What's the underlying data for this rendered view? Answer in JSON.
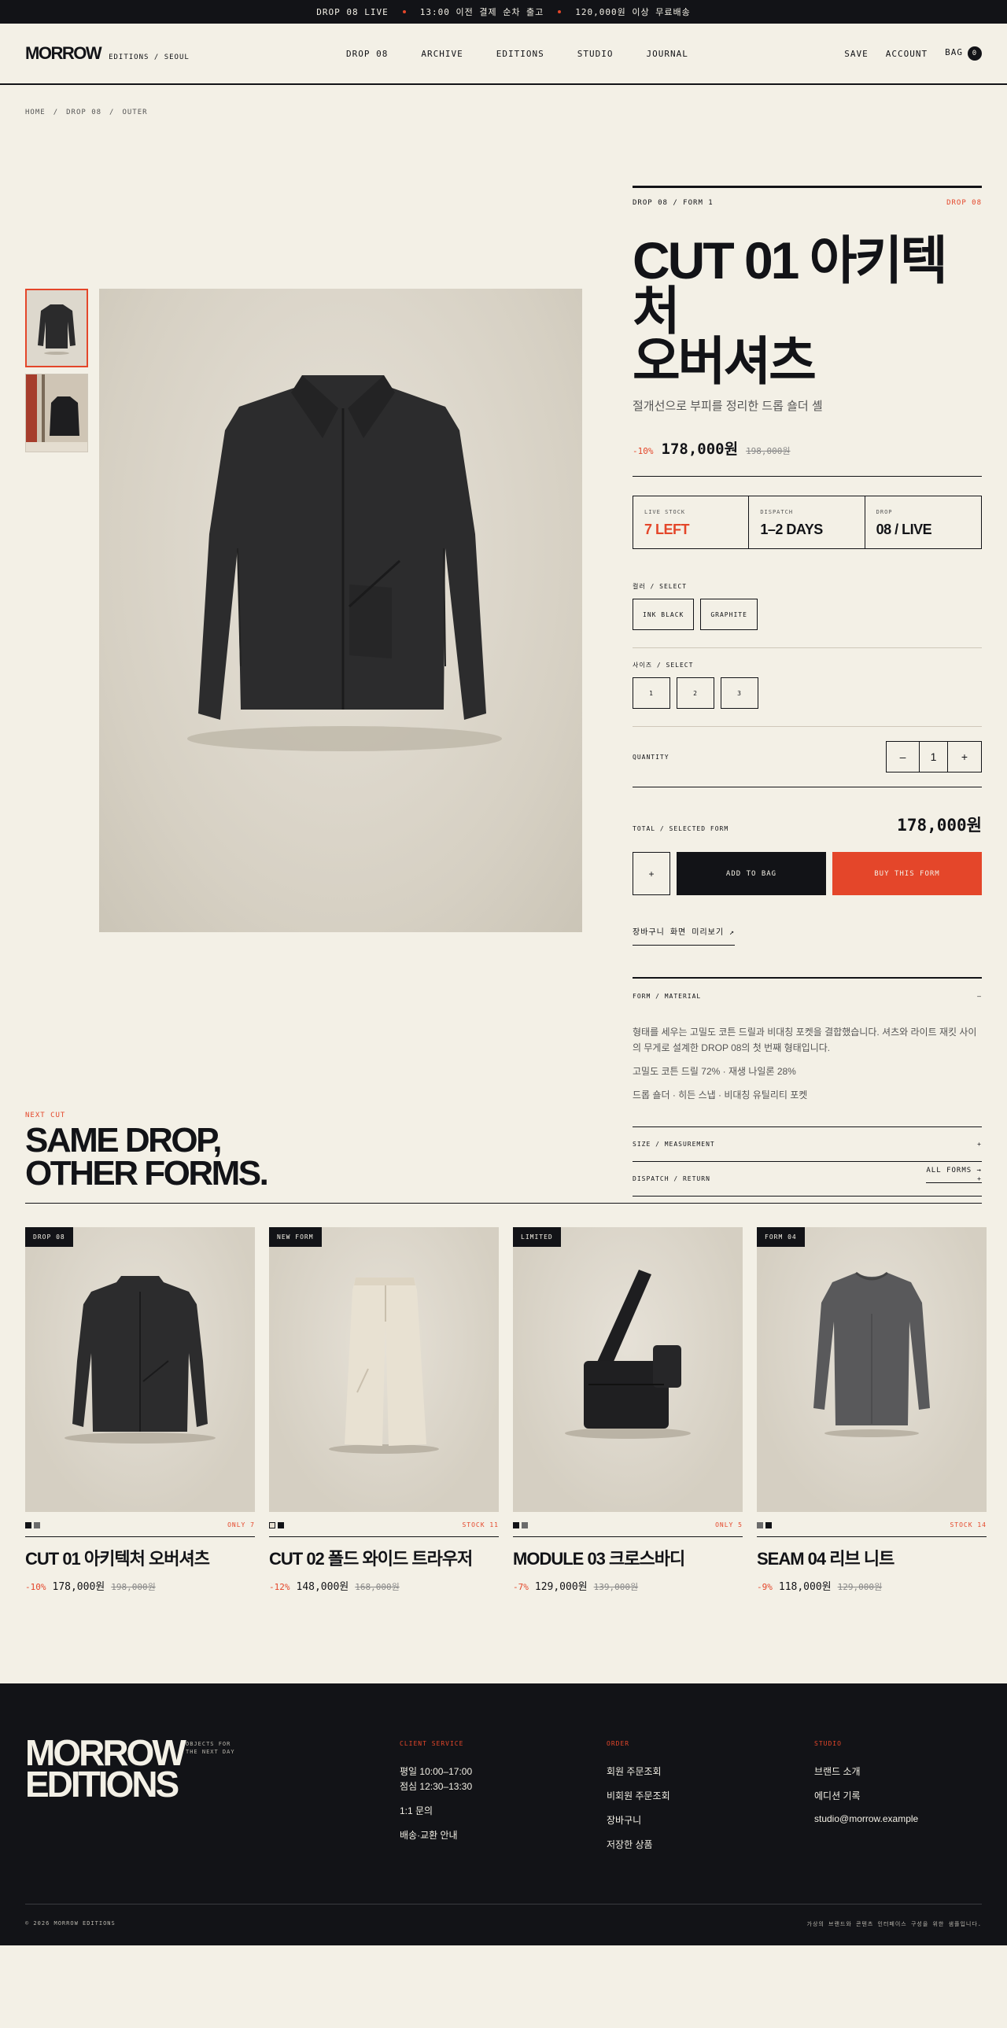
{
  "announcement": {
    "items": [
      "DROP 08 LIVE",
      "13:00 이전 결제 순차 출고",
      "120,000원 이상 무료배송"
    ]
  },
  "header": {
    "logo": "MORROW",
    "logo_sub": "EDITIONS / SEOUL",
    "nav": [
      "DROP 08",
      "ARCHIVE",
      "EDITIONS",
      "STUDIO",
      "JOURNAL"
    ],
    "save": "SAVE",
    "account": "ACCOUNT",
    "bag": "BAG",
    "bag_count": "0"
  },
  "breadcrumb": [
    "HOME",
    "/",
    "DROP 08",
    "/",
    "OUTER"
  ],
  "product": {
    "kicker": "DROP 08 / FORM 1",
    "kicker_right": "DROP 08",
    "title_line1": "CUT 01 아키텍처",
    "title_line2": "오버셔츠",
    "subtitle": "절개선으로 부피를 정리한 드롭 숄더 셸",
    "discount": "-10%",
    "price": "178,000원",
    "original_price": "198,000원",
    "stats": [
      {
        "label": "LIVE STOCK",
        "value": "7 LEFT"
      },
      {
        "label": "DISPATCH",
        "value": "1–2 DAYS"
      },
      {
        "label": "DROP",
        "value": "08 / LIVE"
      }
    ],
    "color_label": "컬러 / SELECT",
    "colors": [
      "INK BLACK",
      "GRAPHITE"
    ],
    "size_label": "사이즈 / SELECT",
    "sizes": [
      "1",
      "2",
      "3"
    ],
    "quantity_label": "QUANTITY",
    "quantity_minus": "–",
    "quantity_value": "1",
    "quantity_plus": "+",
    "total_label": "TOTAL / SELECTED FORM",
    "total_value": "178,000원",
    "wish_symbol": "+",
    "add_to_bag": "ADD TO BAG",
    "buy_now": "BUY THIS FORM",
    "view_link": "장바구니 화면 미리보기 ↗",
    "accordion": [
      {
        "title": "FORM / MATERIAL",
        "toggle": "–"
      },
      {
        "title": "SIZE / MEASUREMENT",
        "toggle": "+"
      },
      {
        "title": "DISPATCH / RETURN",
        "toggle": "+"
      }
    ],
    "material_text": [
      "형태를 세우는 고밀도 코튼 드릴과 비대칭 포켓을 결합했습니다. 셔츠와 라이트 재킷 사이의 무게로 설계한 DROP 08의 첫 번째 형태입니다.",
      "고밀도 코튼 드릴 72% · 재생 나일론 28%",
      "드롭 숄더 · 히든 스냅 · 비대칭 유틸리티 포켓"
    ]
  },
  "others": {
    "kicker": "NEXT CUT",
    "title_line1": "SAME DROP,",
    "title_line2": "OTHER FORMS.",
    "all_forms": "ALL FORMS →",
    "cards": [
      {
        "badge": "DROP 08",
        "stock": "ONLY 7",
        "name": "CUT 01 아키텍처 오버셔츠",
        "discount": "-10%",
        "price": "178,000원",
        "original": "198,000원"
      },
      {
        "badge": "NEW FORM",
        "stock": "STOCK 11",
        "name": "CUT 02 폴드 와이드 트라우저",
        "discount": "-12%",
        "price": "148,000원",
        "original": "168,000원"
      },
      {
        "badge": "LIMITED",
        "stock": "ONLY 5",
        "name": "MODULE 03 크로스바디",
        "discount": "-7%",
        "price": "129,000원",
        "original": "139,000원"
      },
      {
        "badge": "FORM 04",
        "stock": "STOCK 14",
        "name": "SEAM 04 리브 니트",
        "discount": "-9%",
        "price": "118,000원",
        "original": "129,000원"
      }
    ]
  },
  "footer": {
    "logo_line1": "MORROW",
    "logo_line2": "EDITIONS",
    "tagline_1": "OBJECTS FOR",
    "tagline_2": "THE NEXT DAY",
    "cols": [
      {
        "title": "CLIENT SERVICE",
        "items": [
          "평일 10:00–17:00",
          "점심 12:30–13:30",
          "1:1 문의",
          "배송·교환 안내"
        ]
      },
      {
        "title": "ORDER",
        "items": [
          "회원 주문조회",
          "비회원 주문조회",
          "장바구니",
          "저장한 상품"
        ]
      },
      {
        "title": "STUDIO",
        "items": [
          "브랜드 소개",
          "에디션 기록",
          "studio@morrow.example"
        ]
      }
    ],
    "copyright": "© 2026 MORROW EDITIONS",
    "disclaimer": "가상의 브랜드와 콘텐츠 인터페이스 구성을 위한 샘플입니다."
  },
  "colors": {
    "accent": "#e4462a",
    "ink": "#121317",
    "paper": "#f3f0e6"
  }
}
